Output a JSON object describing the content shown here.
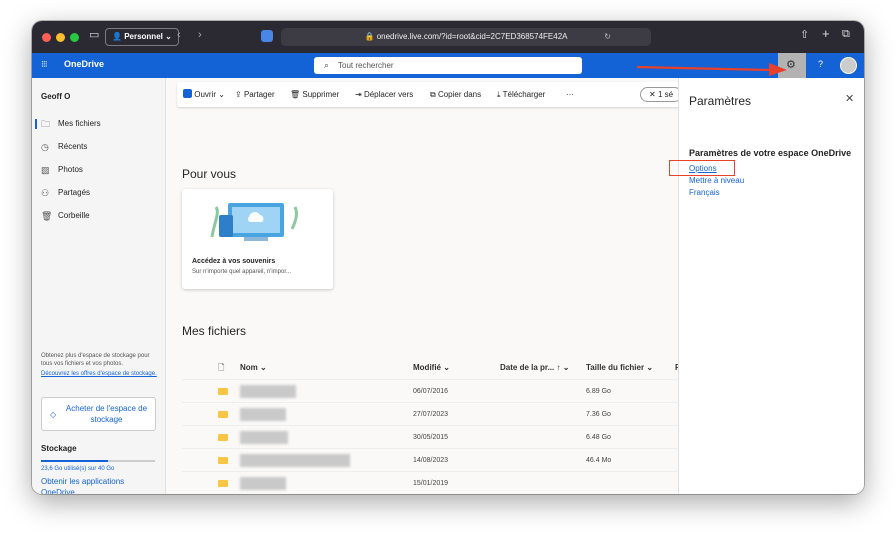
{
  "browser": {
    "profile": "Personnel",
    "url": "onedrive.live.com/?id=root&cid=2C7ED368574FE42A"
  },
  "app": {
    "name": "OneDrive",
    "search_placeholder": "Tout rechercher",
    "user": "Geoff O"
  },
  "sidebar": {
    "items": [
      {
        "label": "Mes fichiers",
        "icon": "folder-icon"
      },
      {
        "label": "Récents",
        "icon": "clock-icon"
      },
      {
        "label": "Photos",
        "icon": "image-icon"
      },
      {
        "label": "Partagés",
        "icon": "people-icon"
      },
      {
        "label": "Corbeille",
        "icon": "trash-icon"
      }
    ],
    "promo_text": "Obtenez plus d'espace de stockage pour tous vos fichiers et vos photos.",
    "promo_link": "Découvrez les offres d'espace de stockage.",
    "buy_button": "Acheter de l'espace de stockage",
    "storage_title": "Stockage",
    "storage_used": "23,6 Go utilisé(s) sur 40 Go",
    "storage_fraction": 0.59,
    "get_apps": "Obtenir les applications OneDrive"
  },
  "commands": {
    "open": "Ouvrir",
    "share": "Partager",
    "delete": "Supprimer",
    "move": "Déplacer vers",
    "copy": "Copier dans",
    "download": "Télécharger",
    "more": "···",
    "selection": "1 sé"
  },
  "for_you": {
    "title": "Pour vous",
    "card_title": "Accédez à vos souvenirs",
    "card_sub": "Sur n'importe quel appareil, n'impor..."
  },
  "files": {
    "title": "Mes fichiers",
    "columns": {
      "name": "Nom",
      "modified": "Modifié",
      "date": "Date de la pr...",
      "size": "Taille du fichier",
      "p": "P"
    },
    "rows": [
      {
        "modified": "06/07/2016",
        "size": "6.89 Go"
      },
      {
        "modified": "27/07/2023",
        "size": "7.36 Go"
      },
      {
        "modified": "30/05/2015",
        "size": "6.48 Go"
      },
      {
        "modified": "14/08/2023",
        "size": "46.4 Mo"
      },
      {
        "modified": "15/01/2019",
        "size": ""
      }
    ]
  },
  "settings": {
    "title": "Paramètres",
    "section": "Paramètres de votre espace OneDrive",
    "options": "Options",
    "upgrade": "Mettre à niveau",
    "language": "Français"
  },
  "colors": {
    "brand": "#1463d6",
    "annotation": "#e8402a"
  }
}
